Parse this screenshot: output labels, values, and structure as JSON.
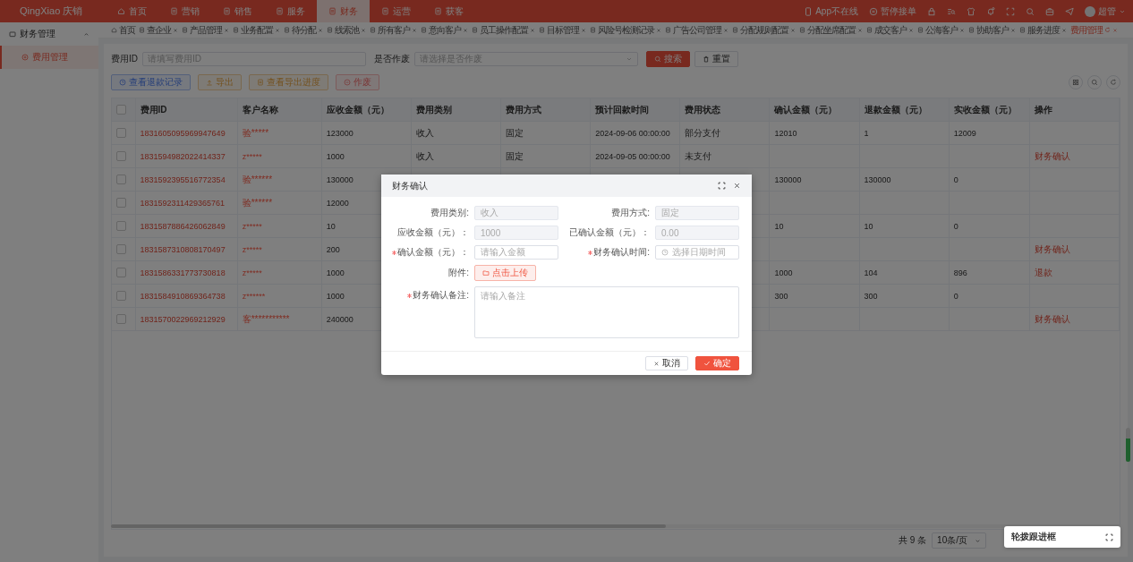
{
  "header": {
    "logo": "QingXiao 庆销",
    "nav": [
      {
        "label": "首页",
        "selected": false
      },
      {
        "label": "营销",
        "selected": false
      },
      {
        "label": "销售",
        "selected": false
      },
      {
        "label": "服务",
        "selected": false
      },
      {
        "label": "财务",
        "selected": true
      },
      {
        "label": "运营",
        "selected": false
      },
      {
        "label": "获客",
        "selected": false
      }
    ],
    "status": [
      "App不在线",
      "暂停接单"
    ],
    "user": "超管"
  },
  "sidebar": {
    "group": {
      "label": "财务管理",
      "expanded": true
    },
    "items": [
      {
        "label": "费用管理",
        "selected": true
      }
    ]
  },
  "tabs": [
    {
      "label": "首页",
      "selected": false,
      "closable": false
    },
    {
      "label": "查企业",
      "selected": false,
      "closable": true
    },
    {
      "label": "产品管理",
      "selected": false,
      "closable": true
    },
    {
      "label": "业务配置",
      "selected": false,
      "closable": true
    },
    {
      "label": "待分配",
      "selected": false,
      "closable": true
    },
    {
      "label": "线索池",
      "selected": false,
      "closable": true
    },
    {
      "label": "所有客户",
      "selected": false,
      "closable": true
    },
    {
      "label": "意向客户",
      "selected": false,
      "closable": true
    },
    {
      "label": "员工操作配置",
      "selected": false,
      "closable": true
    },
    {
      "label": "目标管理",
      "selected": false,
      "closable": true
    },
    {
      "label": "风险号检测记录",
      "selected": false,
      "closable": true
    },
    {
      "label": "广告公司管理",
      "selected": false,
      "closable": true
    },
    {
      "label": "分配规则配置",
      "selected": false,
      "closable": true
    },
    {
      "label": "分配坐席配置",
      "selected": false,
      "closable": true
    },
    {
      "label": "成交客户",
      "selected": false,
      "closable": true
    },
    {
      "label": "公海客户",
      "selected": false,
      "closable": true
    },
    {
      "label": "协助客户",
      "selected": false,
      "closable": true
    },
    {
      "label": "服务进度",
      "selected": false,
      "closable": true
    },
    {
      "label": "费用管理",
      "selected": true,
      "closable": true
    }
  ],
  "search": {
    "fields": [
      {
        "label": "费用ID",
        "placeholder": "请填写费用ID",
        "kind": "text"
      },
      {
        "label": "是否作废",
        "placeholder": "请选择是否作废",
        "kind": "select"
      }
    ],
    "buttons": [
      {
        "label": "搜索",
        "kind": "primary"
      },
      {
        "label": "重置",
        "kind": "plain"
      }
    ]
  },
  "toolbar": [
    {
      "label": "查看退款记录",
      "kind": "info"
    },
    {
      "label": "导出",
      "kind": "warning"
    },
    {
      "label": "查看导出进度",
      "kind": "warning"
    },
    {
      "label": "作废",
      "kind": "danger"
    }
  ],
  "table": {
    "all_checked": false,
    "columns": [
      "费用ID",
      "客户名称",
      "应收金额（元）",
      "费用类别",
      "费用方式",
      "预计回款时间",
      "费用状态",
      "确认金额（元）",
      "退款金额（元）",
      "实收金额（元）",
      "操作"
    ],
    "rows": [
      {
        "checked": false,
        "id": "1831605095969947649",
        "customer": "验*****",
        "receivable": "123000",
        "category": "收入",
        "method": "固定",
        "expected": "2024-09-06 00:00:00",
        "status": "部分支付",
        "confirmed": "12010",
        "refunded": "1",
        "received": "12009"
      },
      {
        "checked": false,
        "id": "1831594982022414337",
        "customer": "z*****",
        "receivable": "1000",
        "category": "收入",
        "method": "固定",
        "expected": "2024-09-05 00:00:00",
        "status": "未支付",
        "action": "财务确认"
      },
      {
        "checked": false,
        "id": "1831592395516772354",
        "customer": "验******",
        "receivable": "130000",
        "confirmed": "130000",
        "refunded": "130000",
        "received": "0"
      },
      {
        "checked": false,
        "id": "1831592311429365761",
        "customer": "验******",
        "receivable": "12000"
      },
      {
        "checked": false,
        "id": "1831587886426062849",
        "customer": "z*****",
        "receivable": "10",
        "confirmed": "10",
        "refunded": "10",
        "received": "0"
      },
      {
        "checked": false,
        "id": "1831587310808170497",
        "customer": "z*****",
        "receivable": "200",
        "action": "财务确认"
      },
      {
        "checked": false,
        "id": "1831586331773730818",
        "customer": "z*****",
        "receivable": "1000",
        "confirmed": "1000",
        "refunded": "104",
        "received": "896",
        "action": "退款"
      },
      {
        "checked": false,
        "id": "1831584910869364738",
        "customer": "z******",
        "receivable": "1000",
        "confirmed": "300",
        "refunded": "300",
        "received": "0"
      },
      {
        "checked": false,
        "id": "1831570022969212929",
        "customer": "客***********",
        "receivable": "240000",
        "action": "财务确认"
      }
    ]
  },
  "pagination": {
    "total": "共 9 条",
    "page_size": "10条/页"
  },
  "dialer_panel": {
    "title": "轮拨跟进框"
  },
  "dialog": {
    "title": "财务确认",
    "fields": [
      {
        "label": "费用类别:",
        "kind": "readonly",
        "value": "收入",
        "required": false
      },
      {
        "label": "费用方式:",
        "kind": "readonly",
        "value": "固定",
        "required": false
      },
      {
        "label": "应收金额（元）：",
        "kind": "readonly",
        "value": "1000",
        "required": false
      },
      {
        "label": "已确认金额（元）：",
        "kind": "readonly",
        "value": "0.00",
        "required": false
      },
      {
        "label": "确认金额（元）：",
        "kind": "input",
        "placeholder": "请输入金额",
        "required": true
      },
      {
        "label": "财务确认时间:",
        "kind": "date",
        "placeholder": "选择日期时间",
        "required": true
      },
      {
        "label": "附件:",
        "kind": "upload",
        "value": "点击上传",
        "required": false
      },
      {
        "label": "财务确认备注:",
        "kind": "textarea",
        "placeholder": "请输入备注",
        "required": true
      }
    ],
    "buttons": [
      {
        "label": "取消",
        "kind": "plain"
      },
      {
        "label": "确定",
        "kind": "primary"
      }
    ]
  }
}
